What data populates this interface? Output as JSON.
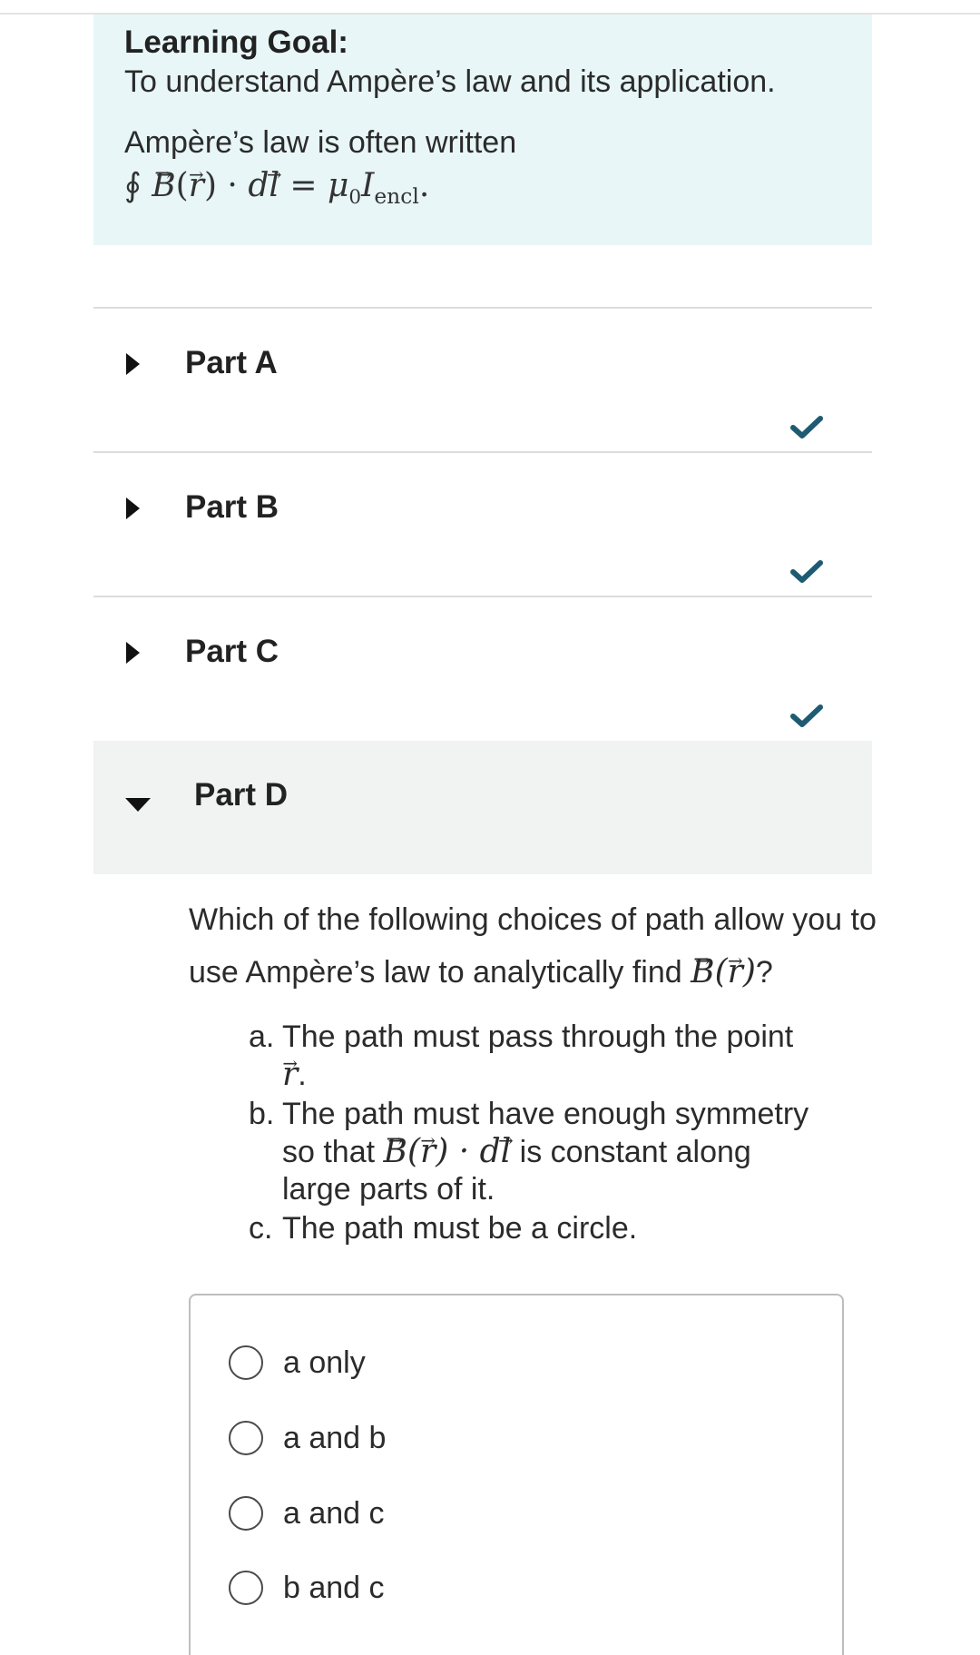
{
  "learning_goal": {
    "heading": "Learning Goal:",
    "text": "To understand Ampère’s law and its application.",
    "intro": "Ampère’s law is often written",
    "formula": "∮ B(r) · dl = μ0 Iencl."
  },
  "parts": [
    {
      "label": "Part A",
      "completed": true
    },
    {
      "label": "Part B",
      "completed": true
    },
    {
      "label": "Part C",
      "completed": true
    },
    {
      "label": "Part D",
      "completed": false,
      "expanded": true
    }
  ],
  "question": {
    "text": "Which of the following choices of path allow you to use Ampère’s law to analytically find B(r)?",
    "options": [
      {
        "letter": "a.",
        "text": "The path must pass through the point r."
      },
      {
        "letter": "b.",
        "text": "The path must have enough symmetry so that B(r) · dl is constant along large parts of it."
      },
      {
        "letter": "c.",
        "text": "The path must be a circle."
      }
    ]
  },
  "answer_choices": [
    "a only",
    "a and b",
    "a and c",
    "b and c"
  ],
  "colors": {
    "goal_background": "#e8f6f7",
    "check": "#1f5a73",
    "expanded_part_background": "#f1f2f2"
  },
  "icons": {
    "collapsed": "triangle-right-icon",
    "expanded": "triangle-down-icon",
    "completed": "checkmark-icon",
    "choice": "radio-circle-icon"
  }
}
